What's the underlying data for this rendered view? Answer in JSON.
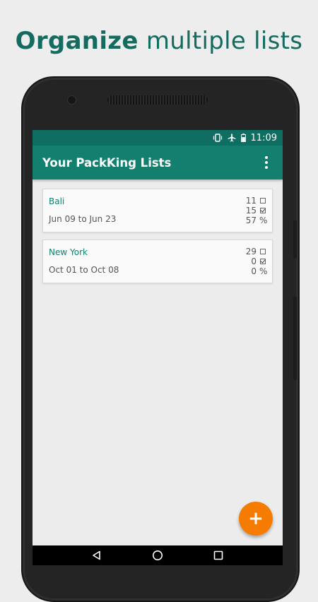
{
  "headline": {
    "bold": "Organize",
    "rest": " multiple lists"
  },
  "status_bar": {
    "time": "11:09",
    "icons": [
      "vibrate-icon",
      "airplane-mode-icon",
      "battery-icon"
    ]
  },
  "app_bar": {
    "title": "Your PackKing Lists",
    "menu_icon": "overflow-menu-icon"
  },
  "lists": [
    {
      "name": "Bali",
      "dates": "Jun 09 to Jun 23",
      "unchecked": "11",
      "checked": "15",
      "percent": "57",
      "percent_symbol": "%"
    },
    {
      "name": "New York",
      "dates": "Oct 01 to Oct 08",
      "unchecked": "29",
      "checked": "0",
      "percent": "0",
      "percent_symbol": "%"
    }
  ],
  "fab": {
    "label": "+",
    "icon": "add-icon"
  },
  "nav_bar": {
    "icons": [
      "back-icon",
      "home-icon",
      "recents-icon"
    ]
  },
  "colors": {
    "headline": "#166b60",
    "status_bar": "#0f6e61",
    "app_bar": "#13806f",
    "accent_text": "#12806f",
    "fab": "#f57c00"
  }
}
